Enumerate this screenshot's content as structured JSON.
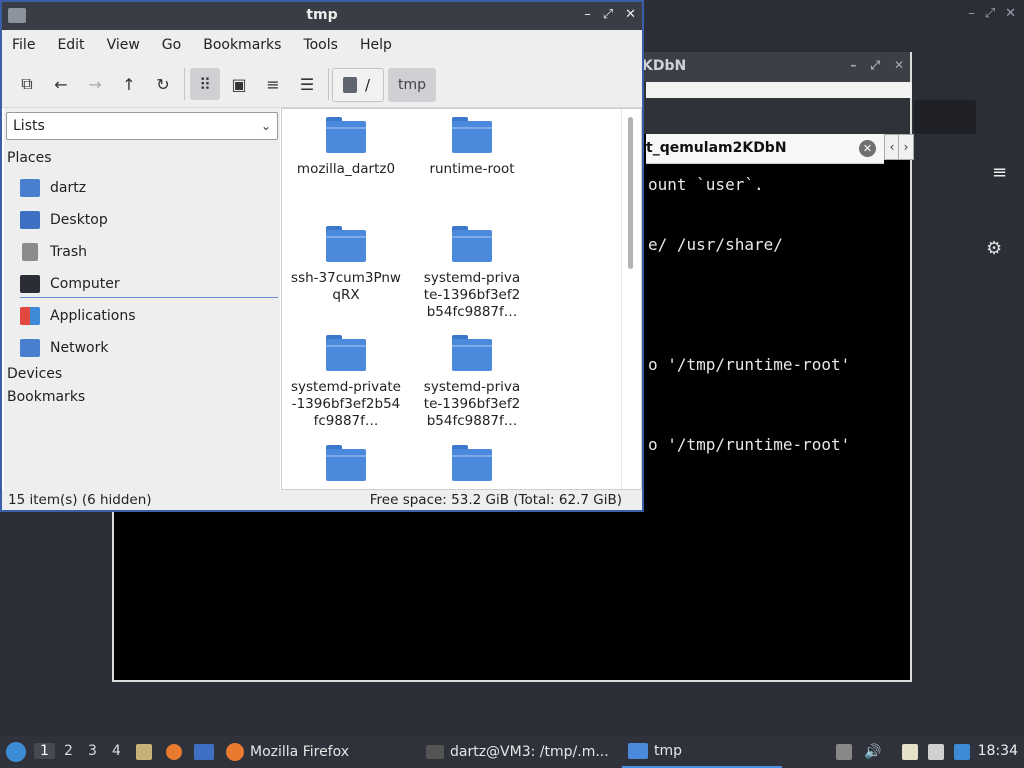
{
  "background_window": {
    "controls": [
      "–",
      "⤢",
      "✕"
    ]
  },
  "terminal": {
    "title_fragment": "KDbN",
    "tab_label": "t_qemulam2KDbN",
    "tab_close": "✕",
    "tab_prev": "‹",
    "tab_next": "›",
    "menu_icon": "≡",
    "gear_icon": "⚙",
    "controls": [
      "–",
      "⤢",
      "✕"
    ],
    "lines": [
      "ount `user`.",
      "e/ /usr/share/",
      "o '/tmp/runtime-root'",
      "o '/tmp/runtime-root'"
    ]
  },
  "file_manager": {
    "title": "tmp",
    "controls": [
      "–",
      "⤢",
      "✕"
    ],
    "menu": [
      "File",
      "Edit",
      "View",
      "Go",
      "Bookmarks",
      "Tools",
      "Help"
    ],
    "toolbar": {
      "new_tab_icon": "⧉",
      "back_icon": "←",
      "forward_icon": "→",
      "up_icon": "↑",
      "reload_icon": "↻",
      "icon_view_icon": "⠿",
      "thumb_view_icon": "▣",
      "compact_view_icon": "≡",
      "list_view_icon": "☰"
    },
    "path": {
      "root_label": "/",
      "current": "tmp"
    },
    "side_pane": {
      "mode": "Lists",
      "places_header": "Places",
      "places": [
        {
          "label": "dartz",
          "icon": "home-folder-icon"
        },
        {
          "label": "Desktop",
          "icon": "desktop-icon"
        },
        {
          "label": "Trash",
          "icon": "trash-icon"
        },
        {
          "label": "Computer",
          "icon": "computer-icon"
        },
        {
          "label": "Applications",
          "icon": "applications-icon"
        },
        {
          "label": "Network",
          "icon": "network-icon"
        }
      ],
      "devices_header": "Devices",
      "bookmarks_header": "Bookmarks"
    },
    "files": [
      "mozilla_dartz0",
      "runtime-root",
      "ssh-37cum3PnwqRX",
      "systemd-private-1396bf3ef2b54fc9887f…",
      "systemd-private-1396bf3ef2b54fc9887f…",
      "systemd-private-1396bf3ef2b54fc9887f…",
      "",
      ""
    ],
    "status": {
      "items": "15 item(s) (6 hidden)",
      "free_space": "Free space: 53.2 GiB (Total: 62.7 GiB)"
    }
  },
  "taskbar": {
    "workspaces": [
      "1",
      "2",
      "3",
      "4"
    ],
    "tasks": [
      {
        "label": "Mozilla Firefox"
      },
      {
        "label": "dartz@VM3: /tmp/.m..."
      },
      {
        "label": "tmp"
      }
    ],
    "clock": "18:34"
  },
  "colors": {
    "accent": "#4a8fe0",
    "folder": "#4b89dc",
    "panel": "#2f323a"
  }
}
